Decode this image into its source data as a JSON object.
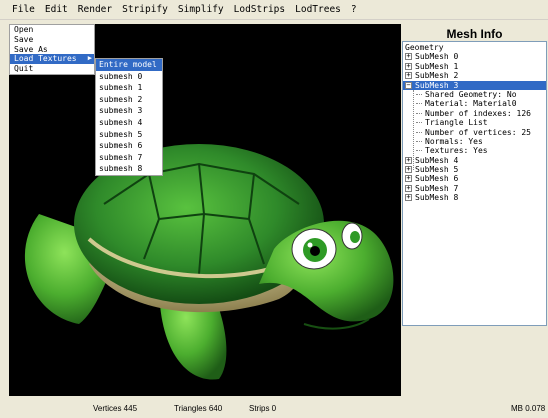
{
  "menubar": [
    "File",
    "Edit",
    "Render",
    "Stripify",
    "Simplify",
    "LodStrips",
    "LodTrees",
    "?"
  ],
  "file_menu": [
    {
      "label": "Open"
    },
    {
      "label": "Save"
    },
    {
      "label": "Save As"
    },
    {
      "label": "Load Textures",
      "highlighted": true
    },
    {
      "label": "Quit"
    }
  ],
  "submenu": [
    {
      "label": "Entire model",
      "highlighted": true
    },
    {
      "label": "submesh 0"
    },
    {
      "label": "submesh 1"
    },
    {
      "label": "submesh 2"
    },
    {
      "label": "submesh 3"
    },
    {
      "label": "submesh 4"
    },
    {
      "label": "submesh 5"
    },
    {
      "label": "submesh 6"
    },
    {
      "label": "submesh 7"
    },
    {
      "label": "submesh 8"
    }
  ],
  "mesh_info": {
    "title": "Mesh Info",
    "root": "Geometry",
    "submeshes_before": [
      "SubMesh 0",
      "SubMesh 1",
      "SubMesh 2"
    ],
    "selected_submesh": "SubMesh 3",
    "selected_properties": [
      "Shared Geometry: No",
      "Material: Material0",
      "Number of indexes: 126",
      "Triangle List",
      "Number of vertices: 25",
      "Normals: Yes",
      "Textures: Yes"
    ],
    "submeshes_after": [
      "SubMesh 4",
      "SubMesh 5",
      "SubMesh 6",
      "SubMesh 7",
      "SubMesh 8"
    ]
  },
  "status": {
    "vertices": "Vertices 445",
    "triangles": "Triangles 640",
    "strips": "Strips 0",
    "memory": "MB 0.078"
  },
  "colors": {
    "selection": "#316ac5",
    "viewport_bg": "#000000",
    "panel_bg": "#ece9d8",
    "shell_green": "#2f8a2a",
    "skin_green": "#5cc13a"
  }
}
